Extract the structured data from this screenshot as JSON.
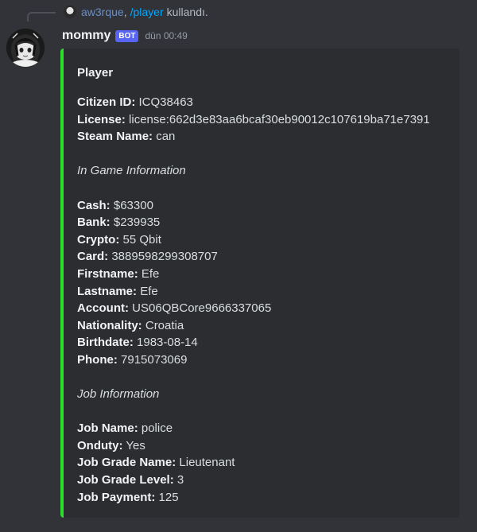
{
  "reply": {
    "user": "aw3rque",
    "separator": ",",
    "command": "/player",
    "used_text": "kullandı."
  },
  "message": {
    "username": "mommy",
    "bot_tag": "BOT",
    "timestamp": "dün 00:49"
  },
  "embed": {
    "accent_color": "#2ae02a",
    "title": "Player",
    "identity": [
      {
        "label": "Citizen ID:",
        "value": "ICQ38463"
      },
      {
        "label": "License:",
        "value": "license:662d3e83aa6bcaf30eb90012c107619ba71e7391"
      },
      {
        "label": "Steam Name:",
        "value": "can"
      }
    ],
    "game_section": "In Game Information",
    "game_info": [
      {
        "label": "Cash:",
        "value": "$63300"
      },
      {
        "label": "Bank:",
        "value": "$239935"
      },
      {
        "label": "Crypto:",
        "value": "55 Qbit"
      },
      {
        "label": "Card:",
        "value": "3889598299308707"
      },
      {
        "label": "Firstname:",
        "value": "Efe"
      },
      {
        "label": "Lastname:",
        "value": "Efe"
      },
      {
        "label": "Account:",
        "value": "US06QBCore9666337065"
      },
      {
        "label": "Nationality:",
        "value": "Croatia"
      },
      {
        "label": "Birthdate:",
        "value": "1983-08-14"
      },
      {
        "label": "Phone:",
        "value": "7915073069"
      }
    ],
    "job_section": "Job Information",
    "job_info": [
      {
        "label": "Job Name:",
        "value": "police"
      },
      {
        "label": "Onduty:",
        "value": "Yes"
      },
      {
        "label": "Job Grade Name:",
        "value": "Lieutenant"
      },
      {
        "label": "Job Grade Level:",
        "value": "3"
      },
      {
        "label": "Job Payment:",
        "value": "125"
      }
    ]
  }
}
